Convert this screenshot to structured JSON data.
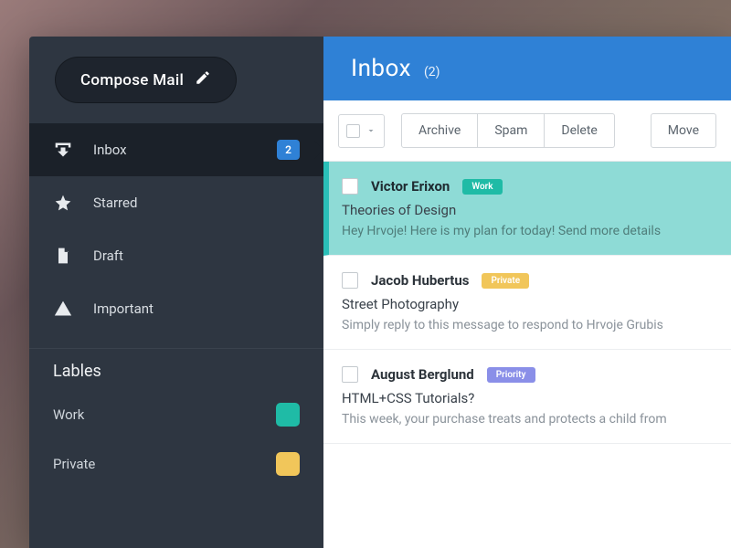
{
  "compose": {
    "label": "Compose Mail"
  },
  "nav": [
    {
      "key": "inbox",
      "label": "Inbox",
      "badge": "2",
      "active": true
    },
    {
      "key": "starred",
      "label": "Starred"
    },
    {
      "key": "draft",
      "label": "Draft"
    },
    {
      "key": "important",
      "label": "Important"
    }
  ],
  "labels_title": "Lables",
  "labels": [
    {
      "key": "work",
      "name": "Work",
      "color": "#1fbba6"
    },
    {
      "key": "private",
      "name": "Private",
      "color": "#f1c65a"
    }
  ],
  "header": {
    "title": "Inbox",
    "count": "(2)"
  },
  "toolbar": {
    "archive": "Archive",
    "spam": "Spam",
    "delete": "Delete",
    "move": "Move"
  },
  "messages": [
    {
      "sender": "Victor Erixon",
      "tag": {
        "text": "Work",
        "color": "#1fbba6"
      },
      "subject": "Theories of Design",
      "preview": "Hey Hrvoje! Here is my plan for today! Send more details",
      "selected": true
    },
    {
      "sender": "Jacob Hubertus",
      "tag": {
        "text": "Private",
        "color": "#f1c65a"
      },
      "subject": "Street Photography",
      "preview": "Simply reply to this message to respond to Hrvoje Grubis",
      "selected": false
    },
    {
      "sender": "August Berglund",
      "tag": {
        "text": "Priority",
        "color": "#8a8fe8"
      },
      "subject": "HTML+CSS Tutorials?",
      "preview": "This week, your purchase treats and protects a child from",
      "selected": false
    }
  ]
}
